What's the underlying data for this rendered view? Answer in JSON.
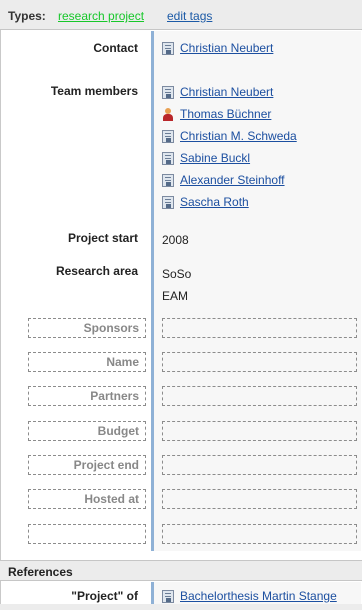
{
  "types": {
    "label": "Types:",
    "tag": "research project",
    "edit_link": "edit tags"
  },
  "fields": {
    "contact": {
      "label": "Contact",
      "value": "Christian Neubert"
    },
    "team_members": {
      "label": "Team members",
      "members": [
        {
          "name": "Christian Neubert",
          "icon": "card-icon"
        },
        {
          "name": "Thomas Büchner",
          "icon": "user-icon"
        },
        {
          "name": "Christian M. Schweda",
          "icon": "card-icon"
        },
        {
          "name": "Sabine Buckl",
          "icon": "card-icon"
        },
        {
          "name": "Alexander Steinhoff",
          "icon": "card-icon"
        },
        {
          "name": "Sascha Roth",
          "icon": "card-icon"
        }
      ]
    },
    "project_start": {
      "label": "Project start",
      "value": "2008"
    },
    "research_area": {
      "label": "Research area",
      "values": [
        "SoSo",
        "EAM"
      ]
    }
  },
  "empty_fields": [
    {
      "label": "Sponsors"
    },
    {
      "label": "Name"
    },
    {
      "label": "Partners"
    },
    {
      "label": "Budget"
    },
    {
      "label": "Project end"
    },
    {
      "label": "Hosted at"
    },
    {
      "label": ""
    }
  ],
  "references": {
    "title": "References",
    "items": [
      {
        "label": "\"Project\" of",
        "value": "Bachelorthesis Martin Stange",
        "icon": "card-icon"
      }
    ]
  },
  "colors": {
    "type_tag": "#17c72a",
    "link": "#1c4fa0",
    "value_border": "#8fb1d6"
  }
}
